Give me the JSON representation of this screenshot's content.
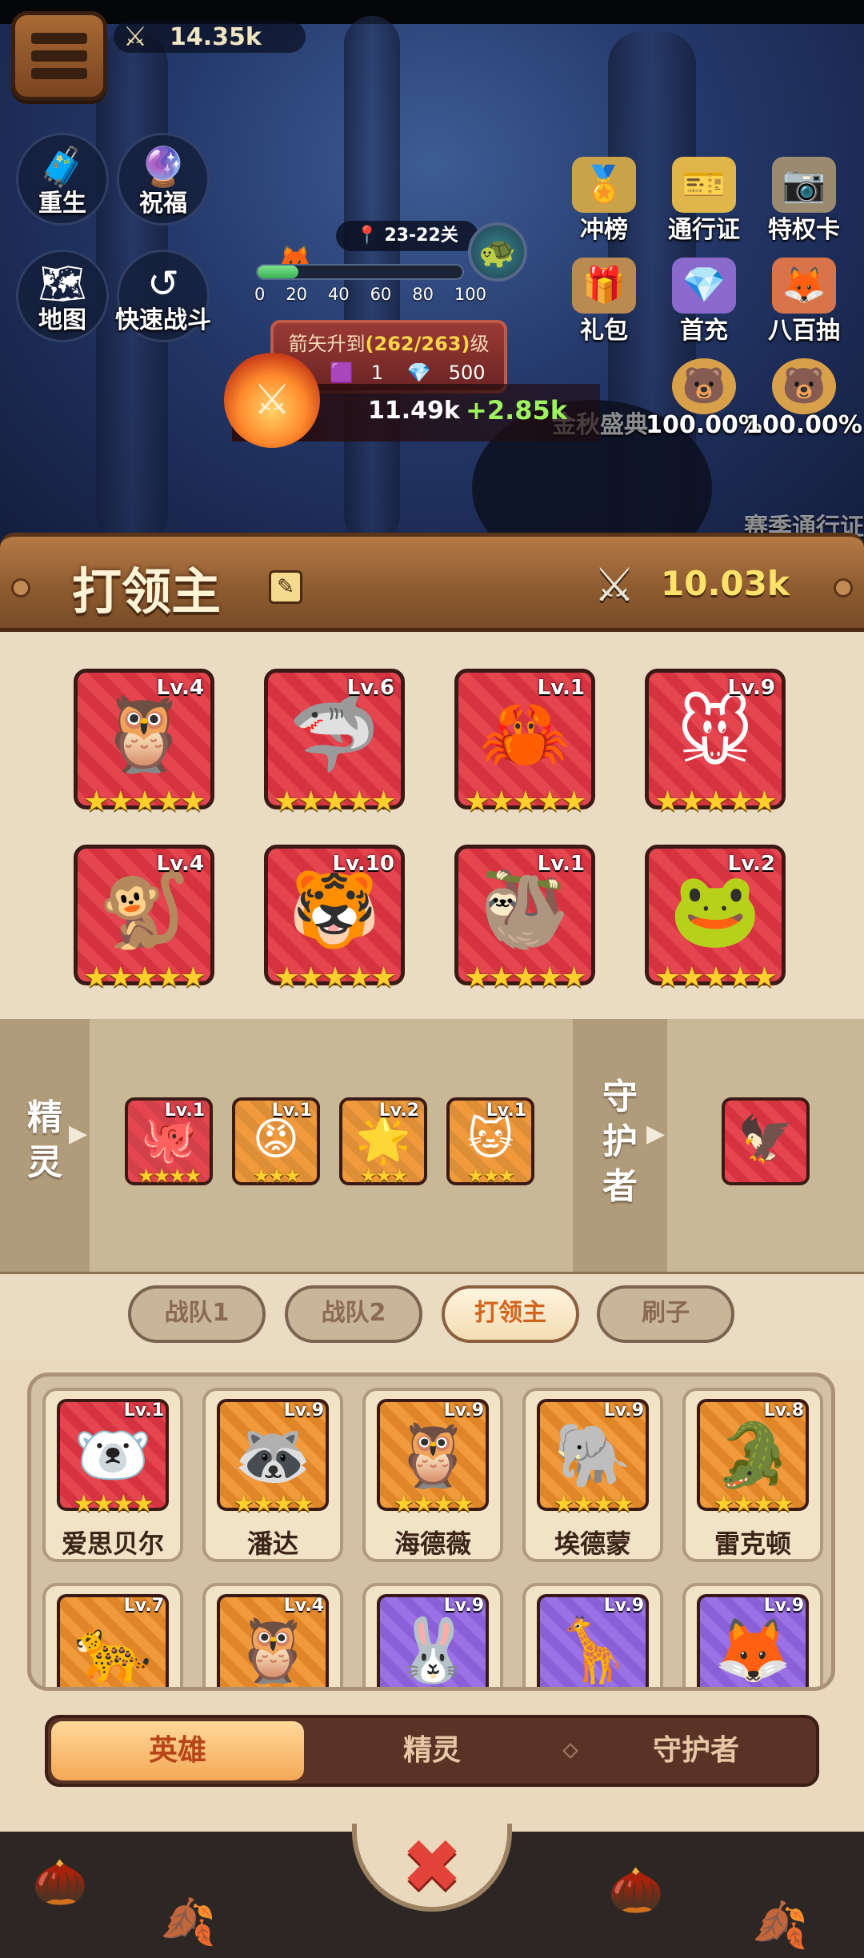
{
  "topbar": {
    "power": "14.35k",
    "menu_icon": "hamburger-icon",
    "power_icon": "crossed-swords-icon"
  },
  "left_buttons": [
    {
      "label": "重生",
      "icon": "rebirth-icon"
    },
    {
      "label": "祝福",
      "icon": "blessing-icon"
    },
    {
      "label": "地图",
      "icon": "map-icon"
    },
    {
      "label": "快速战斗",
      "icon": "quick-battle-icon"
    }
  ],
  "right_buttons": [
    {
      "label": "冲榜",
      "icon": "ranking-icon"
    },
    {
      "label": "通行证",
      "icon": "pass-icon"
    },
    {
      "label": "特权卡",
      "icon": "privilege-card-icon"
    },
    {
      "label": "礼包",
      "icon": "gift-pack-icon"
    },
    {
      "label": "首充",
      "icon": "first-recharge-icon"
    },
    {
      "label": "八百抽",
      "icon": "draw-icon"
    },
    {
      "label": "100.00%",
      "icon": "bear-reward-icon"
    },
    {
      "label": "100.00%",
      "icon": "bear-reward-icon"
    }
  ],
  "faded_labels": {
    "event": "金秋盛典",
    "season_pass": "赛季通行证"
  },
  "stage": {
    "label": "23-22关",
    "progress_pct": 20,
    "ticks": [
      "0",
      "20",
      "40",
      "60",
      "80",
      "100"
    ]
  },
  "upgrade": {
    "prefix": "箭矢升到",
    "highlight": "(262/263)",
    "suffix": "级",
    "item1": "1",
    "item2": "500"
  },
  "combat": {
    "current": "11.49k",
    "delta": "+2.85k"
  },
  "header": {
    "title": "打领主",
    "power": "10.03k"
  },
  "lineup": [
    {
      "level": "Lv.4",
      "stars": 5,
      "face": "🦉"
    },
    {
      "level": "Lv.6",
      "stars": 5,
      "face": "🦈"
    },
    {
      "level": "Lv.1",
      "stars": 5,
      "face": "🦀"
    },
    {
      "level": "Lv.9",
      "stars": 5,
      "face": "🐭"
    },
    {
      "level": "Lv.4",
      "stars": 5,
      "face": "🐒"
    },
    {
      "level": "Lv.10",
      "stars": 5,
      "face": "🐯"
    },
    {
      "level": "Lv.1",
      "stars": 5,
      "face": "🦥"
    },
    {
      "level": "Lv.2",
      "stars": 5,
      "face": "🐸"
    }
  ],
  "support": {
    "spirit_label": [
      "精",
      "灵"
    ],
    "guardian_label": [
      "守",
      "护",
      "者"
    ],
    "spirits": [
      {
        "level": "Lv.1",
        "stars": 4,
        "face": "🐙",
        "color": "#e4454f"
      },
      {
        "level": "Lv.1",
        "stars": 3,
        "face": "😡",
        "color": "#f09a3c"
      },
      {
        "level": "Lv.2",
        "stars": 3,
        "face": "🌟",
        "color": "#f09a3c"
      },
      {
        "level": "Lv.1",
        "stars": 3,
        "face": "🐱",
        "color": "#f09a3c"
      }
    ],
    "guardian": {
      "face": "🦅"
    }
  },
  "team_tabs": [
    "战队1",
    "战队2",
    "打领主",
    "刷子"
  ],
  "active_team": 2,
  "heroes": [
    {
      "name": "爱思贝尔",
      "level": "Lv.1",
      "stars": 4,
      "face": "🐻‍❄️",
      "color": "red"
    },
    {
      "name": "潘达",
      "level": "Lv.9",
      "stars": 4,
      "face": "🦝",
      "color": "orange"
    },
    {
      "name": "海德薇",
      "level": "Lv.9",
      "stars": 4,
      "face": "🦉",
      "color": "orange"
    },
    {
      "name": "埃德蒙",
      "level": "Lv.9",
      "stars": 4,
      "face": "🐘",
      "color": "orange"
    },
    {
      "name": "雷克顿",
      "level": "Lv.8",
      "stars": 4,
      "face": "🐊",
      "color": "orange"
    },
    {
      "name": "",
      "level": "Lv.7",
      "stars": 0,
      "face": "🐆",
      "color": "orange"
    },
    {
      "name": "",
      "level": "Lv.4",
      "stars": 0,
      "face": "🦉",
      "color": "orange"
    },
    {
      "name": "",
      "level": "Lv.9",
      "stars": 0,
      "face": "🐰",
      "color": "purple"
    },
    {
      "name": "",
      "level": "Lv.9",
      "stars": 0,
      "face": "🦒",
      "color": "purple"
    },
    {
      "name": "",
      "level": "Lv.9",
      "stars": 0,
      "face": "🦊",
      "color": "purple"
    }
  ],
  "category_tabs": [
    "英雄",
    "精灵",
    "守护者"
  ],
  "active_category": 0,
  "close_icon": "close-x-icon"
}
